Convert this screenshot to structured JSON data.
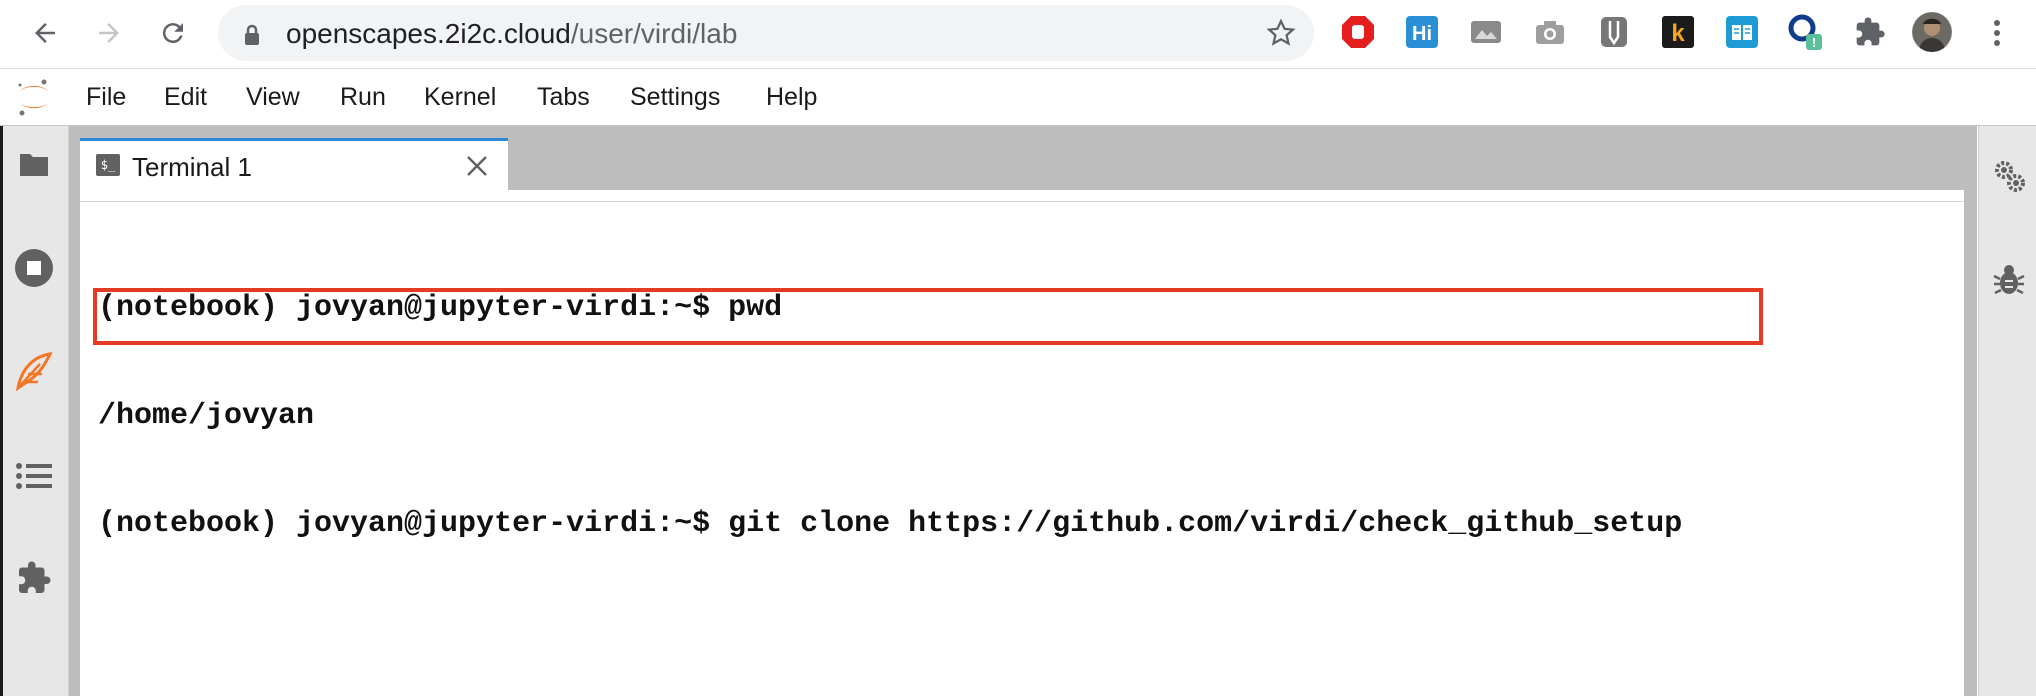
{
  "browser": {
    "url_host": "openscapes.2i2c.cloud",
    "url_path": "/user/virdi/lab",
    "extensions": [
      "adblock-icon",
      "hi-icon",
      "screenshot-extension-icon",
      "camera-icon",
      "clipper-icon",
      "k-icon",
      "reader-icon",
      "q-extension-icon",
      "puzzle-icon",
      "profile-avatar"
    ],
    "ext_badge": "!"
  },
  "menu": {
    "file": "File",
    "edit": "Edit",
    "view": "View",
    "run": "Run",
    "kernel": "Kernel",
    "tabs": "Tabs",
    "settings": "Settings",
    "help": "Help"
  },
  "tab": {
    "label": "Terminal 1",
    "icon_text": "$_"
  },
  "terminal": {
    "lines": [
      "(notebook) jovyan@jupyter-virdi:~$ pwd",
      "/home/jovyan",
      "(notebook) jovyan@jupyter-virdi:~$ git clone https://github.com/virdi/check_github_setup"
    ]
  },
  "colors": {
    "tab_accent": "#2e8ad9",
    "highlight": "#e53a23",
    "jupyter_orange": "#f37626"
  }
}
